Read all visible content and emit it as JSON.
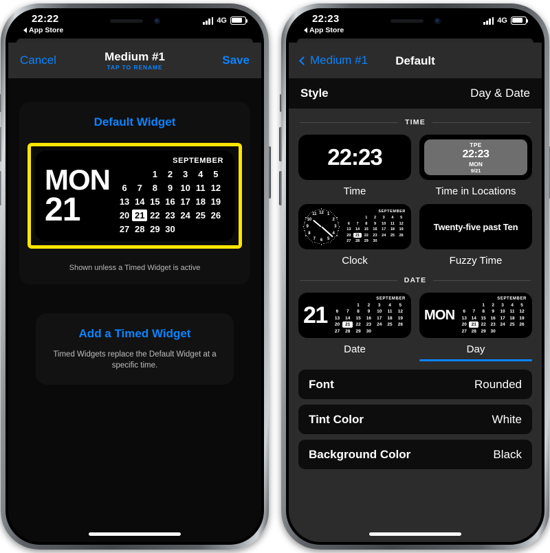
{
  "colors": {
    "accent_blue": "#0a84ff",
    "highlight_yellow": "#ffe600",
    "app_background": "#2c2c2c",
    "card_background": "#0d0d0d",
    "widget_background": "#000000",
    "text_white": "#ffffff"
  },
  "left_phone": {
    "status_bar": {
      "time": "22:22",
      "back_label": "App Store",
      "network": "4G"
    },
    "navbar": {
      "cancel_label": "Cancel",
      "title": "Medium #1",
      "subtitle": "TAP TO RENAME",
      "save_label": "Save"
    },
    "default_card": {
      "title": "Default Widget",
      "footer": "Shown unless a Timed Widget is active"
    },
    "timed_card": {
      "title": "Add a Timed Widget",
      "subtitle": "Timed Widgets replace the Default Widget at a specific time."
    }
  },
  "right_phone": {
    "status_bar": {
      "time": "22:23",
      "back_label": "App Store",
      "network": "4G"
    },
    "navbar": {
      "back_label": "Medium #1",
      "title": "Default"
    },
    "style_row": {
      "label": "Style",
      "value": "Day & Date"
    },
    "sections": [
      {
        "label": "TIME"
      },
      {
        "label": "DATE"
      }
    ],
    "time_options": [
      {
        "label": "Time",
        "selected": false,
        "value": "22:23"
      },
      {
        "label": "Time in Locations",
        "selected": false,
        "city": "TPE",
        "time": "22:23",
        "day": "MON",
        "date": "9/21"
      },
      {
        "label": "Clock",
        "selected": false
      },
      {
        "label": "Fuzzy Time",
        "selected": false,
        "value": "Twenty-five past Ten"
      }
    ],
    "date_options": [
      {
        "label": "Date",
        "selected": false,
        "value": "21"
      },
      {
        "label": "Day",
        "selected": true,
        "value": "MON"
      }
    ],
    "settings": [
      {
        "label": "Font",
        "value": "Rounded"
      },
      {
        "label": "Tint Color",
        "value": "White"
      },
      {
        "label": "Background Color",
        "value": "Black"
      }
    ]
  },
  "widget": {
    "day": "MON",
    "date": "21",
    "month": "SEPTEMBER",
    "today": 21,
    "lead_blanks": 2,
    "days_in_month": 30,
    "clock_numbers": [
      "12",
      "1",
      "2",
      "3",
      "4",
      "5",
      "6",
      "7",
      "8",
      "9",
      "10",
      "11"
    ],
    "clock_hour_angle": 310,
    "clock_minute_angle": 132
  }
}
